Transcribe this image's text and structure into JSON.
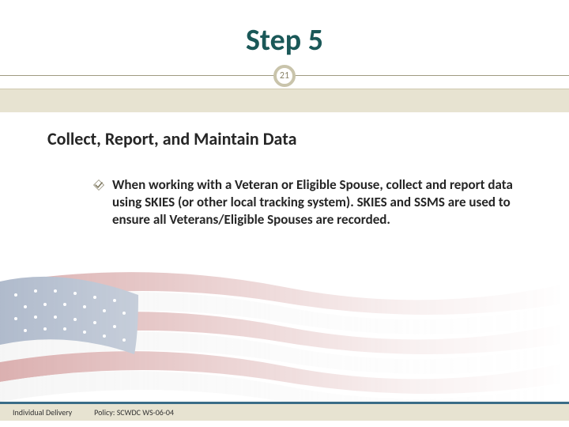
{
  "title": "Step 5",
  "page_number": "21",
  "subtitle": "Collect, Report, and Maintain Data",
  "bullets": [
    "When working with a Veteran or Eligible Spouse, collect and report data using SKIES (or other local tracking system). SKIES and SSMS are used to ensure all Veterans/Eligible Spouses are recorded."
  ],
  "footer": {
    "left": "Individual Delivery",
    "right": "Policy: SCWDC WS-06-04"
  },
  "colors": {
    "title": "#1a5858",
    "beige": "#e7e3d1",
    "footer_rule": "#3a6c87"
  }
}
